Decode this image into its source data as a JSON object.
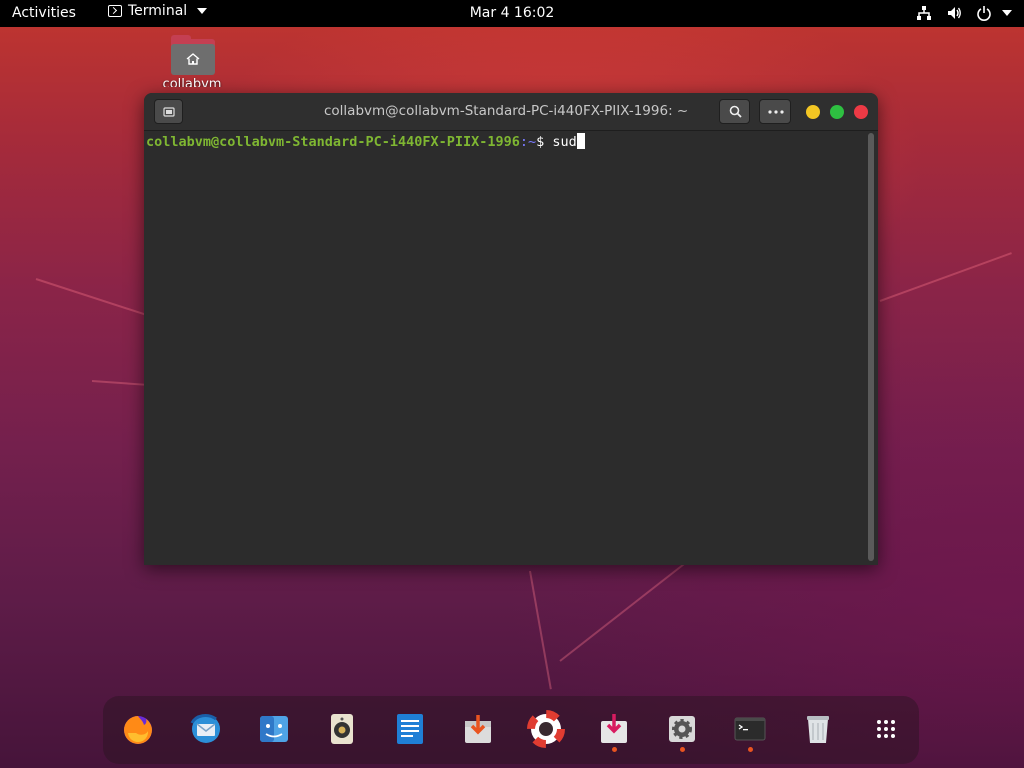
{
  "topbar": {
    "activities_label": "Activities",
    "app_menu_label": "Terminal",
    "clock": "Mar 4  16:02"
  },
  "desktop": {
    "home_folder_label": "collabvm"
  },
  "terminal_window": {
    "title": "collabvm@collabvm-Standard-PC-i440FX-PIIX-1996: ~",
    "prompt_user_host": "collabvm@collabvm-Standard-PC-i440FX-PIIX-1996",
    "prompt_path": ":~",
    "prompt_symbol": "$ ",
    "typed_command": "sud"
  },
  "dock": {
    "items": [
      {
        "name": "firefox",
        "running": false
      },
      {
        "name": "thunderbird",
        "running": false
      },
      {
        "name": "file-manager",
        "running": false
      },
      {
        "name": "rhythmbox",
        "running": false
      },
      {
        "name": "libreoffice-writer",
        "running": false
      },
      {
        "name": "software-install",
        "running": false
      },
      {
        "name": "help",
        "running": false
      },
      {
        "name": "software-updater",
        "running": true
      },
      {
        "name": "settings",
        "running": true
      },
      {
        "name": "terminal",
        "running": true
      },
      {
        "name": "trash",
        "running": false
      },
      {
        "name": "show-applications",
        "running": false
      }
    ]
  },
  "colors": {
    "prompt_green": "#7fb732",
    "ubuntu_orange": "#e95420",
    "close_red": "#ed3a45",
    "maximize_green": "#2ec041",
    "minimize_yellow": "#f3c623"
  }
}
